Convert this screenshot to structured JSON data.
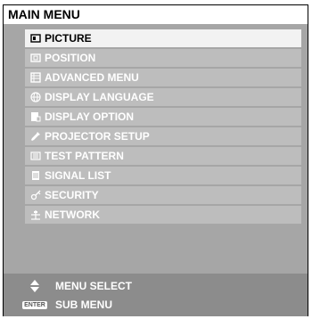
{
  "window": {
    "title": "MAIN MENU"
  },
  "menu": {
    "items": [
      {
        "label": "PICTURE",
        "icon": "picture-icon",
        "selected": true
      },
      {
        "label": "POSITION",
        "icon": "position-icon",
        "selected": false
      },
      {
        "label": "ADVANCED MENU",
        "icon": "advanced-menu-icon",
        "selected": false
      },
      {
        "label": "DISPLAY LANGUAGE",
        "icon": "globe-icon",
        "selected": false
      },
      {
        "label": "DISPLAY OPTION",
        "icon": "display-option-icon",
        "selected": false
      },
      {
        "label": "PROJECTOR SETUP",
        "icon": "wrench-icon",
        "selected": false
      },
      {
        "label": "TEST PATTERN",
        "icon": "test-pattern-icon",
        "selected": false
      },
      {
        "label": "SIGNAL LIST",
        "icon": "signal-list-icon",
        "selected": false
      },
      {
        "label": "SECURITY",
        "icon": "key-icon",
        "selected": false
      },
      {
        "label": "NETWORK",
        "icon": "network-icon",
        "selected": false
      }
    ]
  },
  "footer": {
    "menu_select_label": "MENU SELECT",
    "sub_menu_label": "SUB MENU",
    "enter_key_label": "ENTER"
  }
}
